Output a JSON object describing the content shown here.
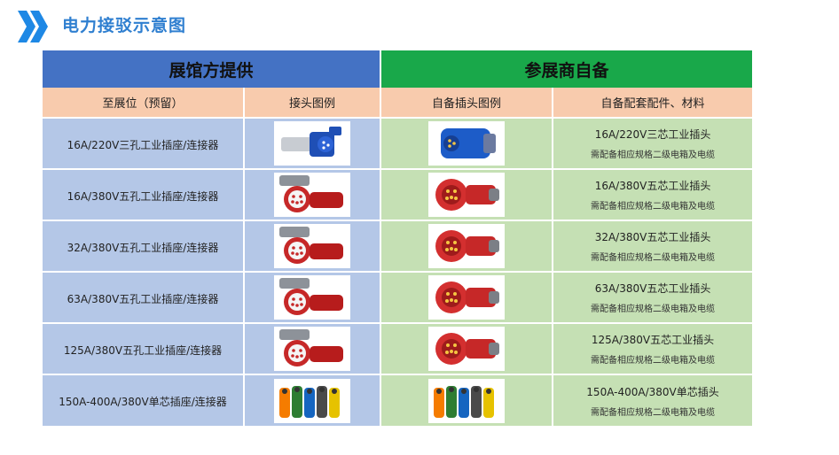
{
  "title": "电力接驳示意图",
  "header": {
    "left_group": "展馆方提供",
    "right_group": "参展商自备",
    "columns": [
      "至展位（预留）",
      "接头图例",
      "自备插头图例",
      "自备配套配件、材料"
    ]
  },
  "note": "需配备相应规格二级电箱及电缆",
  "rows": [
    {
      "socket": "16A/220V三孔工业插座/连接器",
      "plug": "16A/220V三芯工业插头",
      "socket_icon": "blue-industrial-socket",
      "plug_icon": "blue-industrial-plug"
    },
    {
      "socket": "16A/380V五孔工业插座/连接器",
      "plug": "16A/380V五芯工业插头",
      "socket_icon": "red-industrial-socket",
      "plug_icon": "red-industrial-plug"
    },
    {
      "socket": "32A/380V五孔工业插座/连接器",
      "plug": "32A/380V五芯工业插头",
      "socket_icon": "red-industrial-socket",
      "plug_icon": "red-industrial-plug"
    },
    {
      "socket": "63A/380V五孔工业插座/连接器",
      "plug": "63A/380V五芯工业插头",
      "socket_icon": "red-industrial-socket",
      "plug_icon": "red-industrial-plug"
    },
    {
      "socket": "125A/380V五孔工业插座/连接器",
      "plug": "125A/380V五芯工业插头",
      "socket_icon": "red-industrial-socket",
      "plug_icon": "red-industrial-plug"
    },
    {
      "socket": "150A-400A/380V单芯插座/连接器",
      "plug": "150A-400A/380V单芯插头",
      "socket_icon": "single-core-connectors",
      "plug_icon": "single-core-connectors"
    }
  ],
  "colors": {
    "title": "#2f7fd0",
    "left_group": "#4472c4",
    "right_group": "#19a84a",
    "subheader": "#f8cbad",
    "left_cells": "#b4c7e7",
    "right_cells": "#c5e0b4"
  }
}
